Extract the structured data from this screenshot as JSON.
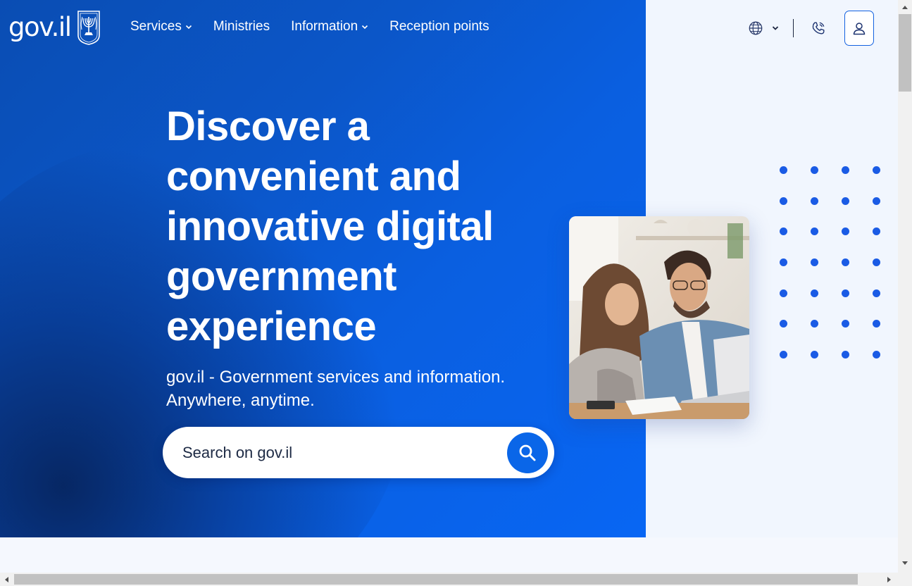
{
  "header": {
    "logo_text": "gov.il",
    "nav": [
      {
        "label": "Services",
        "has_dropdown": true
      },
      {
        "label": "Ministries",
        "has_dropdown": false
      },
      {
        "label": "Information",
        "has_dropdown": true
      },
      {
        "label": "Reception points",
        "has_dropdown": false
      }
    ],
    "icons": [
      "globe-icon",
      "chevron-down-icon",
      "phone-icon",
      "user-icon"
    ]
  },
  "hero": {
    "title_lines": [
      "Discover a",
      "convenient and",
      "innovative digital",
      "government",
      "experience"
    ],
    "subtitle_lines": [
      "gov.il - Government services and information.",
      "Anywhere, anytime."
    ]
  },
  "search": {
    "placeholder": "Search on gov.il",
    "button_icon": "search-icon"
  },
  "colors": {
    "hero_blue": "#0a5fe0",
    "hero_dark": "#062a6e",
    "accent": "#0a66e8",
    "dots": "#1a5be5",
    "page_bg": "#f1f6fe"
  }
}
